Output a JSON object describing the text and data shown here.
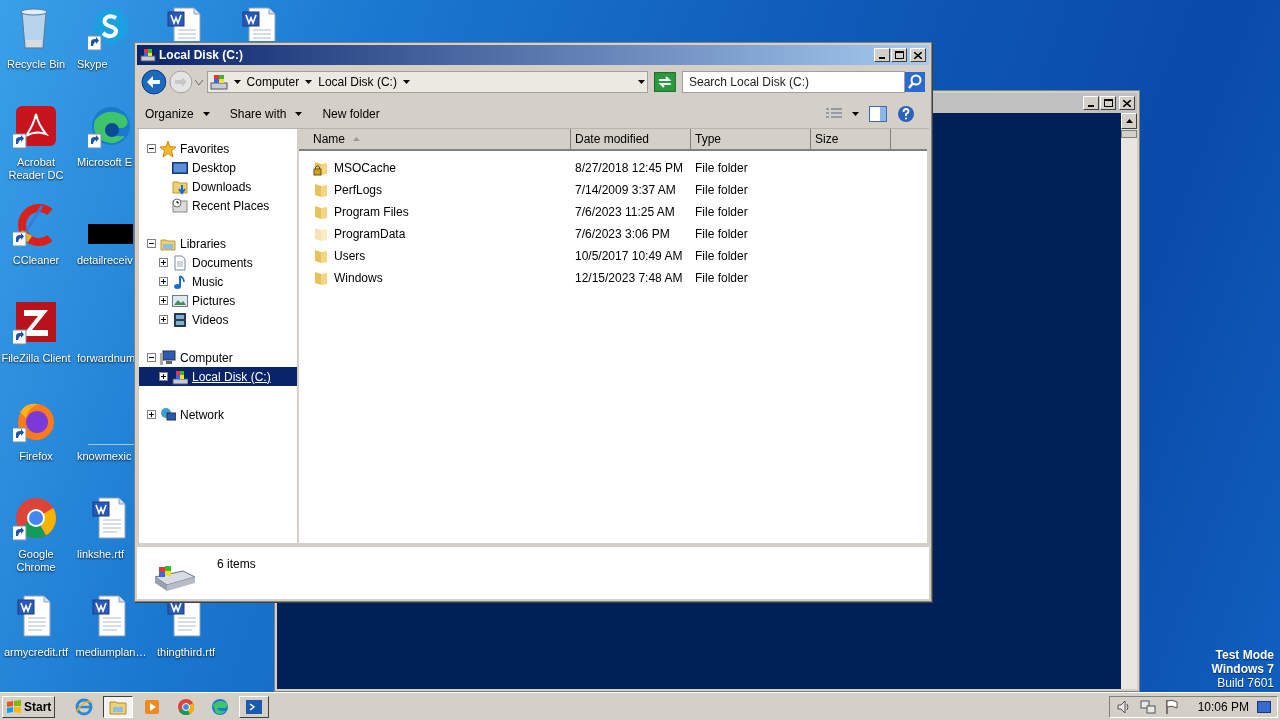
{
  "desktop": {
    "icons": [
      {
        "label": "Recycle Bin",
        "kind": "recycle",
        "shortcut": false
      },
      {
        "label": "Skype",
        "kind": "skype",
        "shortcut": true
      },
      {
        "kind": "document",
        "shortcut": false
      },
      {
        "kind": "document",
        "shortcut": false
      },
      {
        "label": "Acrobat Reader DC",
        "kind": "acrobat",
        "shortcut": true
      },
      {
        "label": "Microsoft E",
        "kind": "edge",
        "shortcut": true
      },
      {
        "label": "CCleaner",
        "kind": "ccleaner",
        "shortcut": true
      },
      {
        "label": "detailreceiv",
        "kind": "blackbox",
        "shortcut": false
      },
      {
        "label": "FileZilla Client",
        "kind": "filezilla",
        "shortcut": true
      },
      {
        "label": "forwardnum",
        "kind": "blank",
        "shortcut": false
      },
      {
        "label": "Firefox",
        "kind": "firefox",
        "shortcut": true
      },
      {
        "label": "knowmexic",
        "kind": "blank",
        "shortcut": false
      },
      {
        "label": "Google Chrome",
        "kind": "chrome",
        "shortcut": true
      },
      {
        "label": "linkshe.rtf",
        "kind": "document",
        "shortcut": false
      },
      {
        "label": "armycredit.rtf",
        "kind": "document",
        "shortcut": false
      },
      {
        "label": "mediumplan…",
        "kind": "document",
        "shortcut": false
      },
      {
        "label": "thingthird.rtf",
        "kind": "document",
        "shortcut": false
      }
    ],
    "system_note": [
      {
        "text": "Test Mode",
        "bold": true
      },
      {
        "text": "Windows 7",
        "bold": true
      },
      {
        "text": "Build 7601",
        "bold": false
      }
    ]
  },
  "explorer": {
    "title": "Local Disk (C:)",
    "address": {
      "segments": [
        "Computer",
        "Local Disk (C:)"
      ]
    },
    "search": {
      "placeholder": "Search Local Disk (C:)"
    },
    "toolbar": [
      {
        "label": "Organize",
        "dropdown": true
      },
      {
        "label": "Share with",
        "dropdown": true
      },
      {
        "label": "New folder",
        "dropdown": false
      }
    ],
    "nav": [
      {
        "label": "Favorites",
        "kind": "star",
        "expanded": true,
        "selected": false,
        "children": [
          {
            "label": "Desktop",
            "kind": "desktop",
            "selected": false
          },
          {
            "label": "Downloads",
            "kind": "downloads",
            "selected": false
          },
          {
            "label": "Recent Places",
            "kind": "recent",
            "selected": false
          }
        ]
      },
      {
        "label": "Libraries",
        "kind": "libraries",
        "expanded": true,
        "selected": false,
        "children": [
          {
            "label": "Documents",
            "kind": "documents",
            "expanded": false,
            "selected": false
          },
          {
            "label": "Music",
            "kind": "music",
            "expanded": false,
            "selected": false
          },
          {
            "label": "Pictures",
            "kind": "pictures",
            "expanded": false,
            "selected": false
          },
          {
            "label": "Videos",
            "kind": "videos",
            "expanded": false,
            "selected": false
          }
        ]
      },
      {
        "label": "Computer",
        "kind": "computer",
        "expanded": true,
        "selected": false,
        "children": [
          {
            "label": "Local Disk (C:)",
            "kind": "drive",
            "expanded": false,
            "selected": true
          }
        ]
      },
      {
        "label": "Network",
        "kind": "network",
        "expanded": false,
        "selected": false
      }
    ],
    "columns": [
      {
        "label": "Name",
        "sorted": true
      },
      {
        "label": "Date modified",
        "sorted": false
      },
      {
        "label": "Type",
        "sorted": false
      },
      {
        "label": "Size",
        "sorted": false
      }
    ],
    "rows": [
      {
        "name": "MSOCache",
        "date": "8/27/2018 12:45 PM",
        "type": "File folder",
        "kind": "locked"
      },
      {
        "name": "PerfLogs",
        "date": "7/14/2009 3:37 AM",
        "type": "File folder",
        "kind": "normal"
      },
      {
        "name": "Program Files",
        "date": "7/6/2023 11:25 AM",
        "type": "File folder",
        "kind": "normal"
      },
      {
        "name": "ProgramData",
        "date": "7/6/2023 3:06 PM",
        "type": "File folder",
        "kind": "hidden"
      },
      {
        "name": "Users",
        "date": "10/5/2017 10:49 AM",
        "type": "File folder",
        "kind": "normal"
      },
      {
        "name": "Windows",
        "date": "12/15/2023 7:48 AM",
        "type": "File folder",
        "kind": "normal"
      }
    ],
    "status": "6 items"
  },
  "taskbar": {
    "start": "Start",
    "apps": [
      {
        "kind": "ie",
        "selected": false,
        "running": false
      },
      {
        "kind": "explorer",
        "selected": true,
        "running": true
      },
      {
        "kind": "media",
        "selected": false,
        "running": false
      },
      {
        "kind": "chrome",
        "selected": false,
        "running": false
      },
      {
        "kind": "edge",
        "selected": false,
        "running": false
      },
      {
        "kind": "powershell",
        "selected": false,
        "running": true
      }
    ],
    "time": "10:06 PM"
  }
}
